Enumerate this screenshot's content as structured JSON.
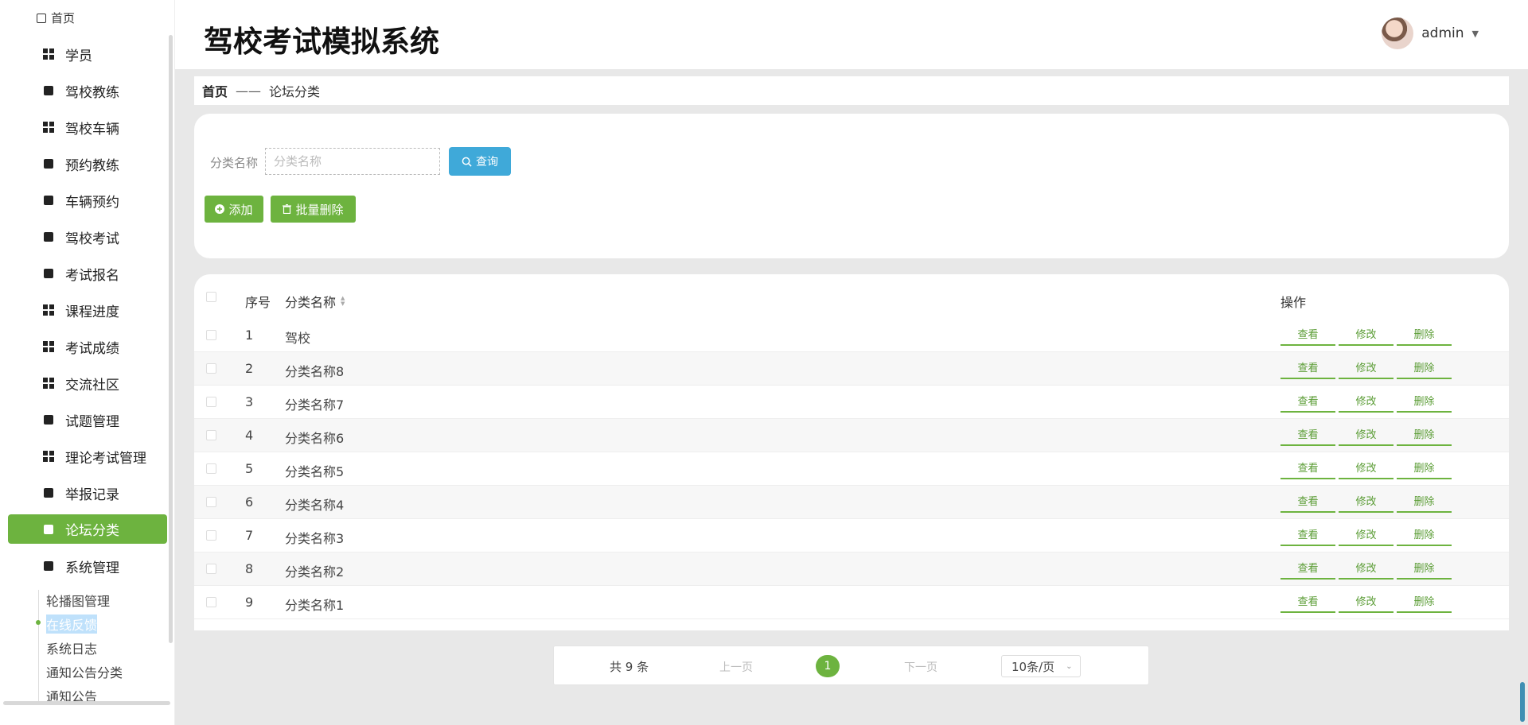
{
  "sidebar": {
    "home_label": "首页",
    "items": [
      {
        "label": "学员",
        "icon": "grid-icon"
      },
      {
        "label": "驾校教练",
        "icon": "monitor-icon"
      },
      {
        "label": "驾校车辆",
        "icon": "grid-icon"
      },
      {
        "label": "预约教练",
        "icon": "clipboard-icon"
      },
      {
        "label": "车辆预约",
        "icon": "wallet-icon"
      },
      {
        "label": "驾校考试",
        "icon": "clipboard-x-icon"
      },
      {
        "label": "考试报名",
        "icon": "books-icon"
      },
      {
        "label": "课程进度",
        "icon": "grid-icon"
      },
      {
        "label": "考试成绩",
        "icon": "grid-icon"
      },
      {
        "label": "交流社区",
        "icon": "grid-icon"
      },
      {
        "label": "试题管理",
        "icon": "sliders-icon"
      },
      {
        "label": "理论考试管理",
        "icon": "grid-icon"
      },
      {
        "label": "举报记录",
        "icon": "stamp-icon"
      },
      {
        "label": "论坛分类",
        "icon": "sign-icon",
        "active": true
      },
      {
        "label": "系统管理",
        "icon": "user-icon"
      }
    ],
    "sub_items": [
      "轮播图管理",
      "在线反馈",
      "系统日志",
      "通知公告分类",
      "通知公告"
    ]
  },
  "header": {
    "title": "驾校考试模拟系统",
    "username": "admin"
  },
  "breadcrumb": {
    "home": "首页",
    "separator": "——",
    "current": "论坛分类"
  },
  "search": {
    "label": "分类名称",
    "placeholder": "分类名称",
    "query_label": "查询"
  },
  "actions": {
    "add_label": "添加",
    "batch_delete_label": "批量删除"
  },
  "table": {
    "columns": {
      "index": "序号",
      "name": "分类名称",
      "ops": "操作"
    },
    "rows": [
      {
        "index": "1",
        "name": "驾校"
      },
      {
        "index": "2",
        "name": "分类名称8"
      },
      {
        "index": "3",
        "name": "分类名称7"
      },
      {
        "index": "4",
        "name": "分类名称6"
      },
      {
        "index": "5",
        "name": "分类名称5"
      },
      {
        "index": "6",
        "name": "分类名称4"
      },
      {
        "index": "7",
        "name": "分类名称3"
      },
      {
        "index": "8",
        "name": "分类名称2"
      },
      {
        "index": "9",
        "name": "分类名称1"
      }
    ],
    "op_labels": {
      "view": "查看",
      "edit": "修改",
      "delete": "删除"
    }
  },
  "pager": {
    "total": "共 9 条",
    "prev": "上一页",
    "current_page": "1",
    "next": "下一页",
    "page_size": "10条/页"
  },
  "colors": {
    "accent": "#6db33f",
    "query": "#3fa9d9",
    "background": "#e8e8e8"
  }
}
